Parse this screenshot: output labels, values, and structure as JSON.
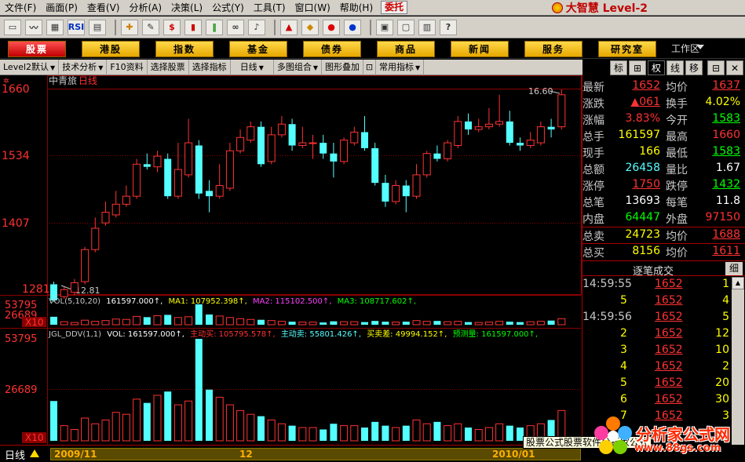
{
  "menu": [
    "文件(F)",
    "画面(P)",
    "查看(V)",
    "分析(A)",
    "决策(L)",
    "公式(Y)",
    "工具(T)",
    "窗口(W)",
    "帮助(H)"
  ],
  "entrust": "委托",
  "brand": "大智慧 Level-2",
  "toolbar": {
    "rsi": "RSI",
    "dollar": "$"
  },
  "nav": [
    "股票",
    "港股",
    "指数",
    "基金",
    "债券",
    "商品",
    "新闻",
    "服务",
    "研究室"
  ],
  "workspace": "工作区",
  "subbar": [
    "Level2默认",
    "技术分析",
    "F10资料",
    "选择股票",
    "选择指标",
    "日线",
    "多图组合",
    "图形叠加",
    "常用指标"
  ],
  "right_tabs": [
    "标",
    "⊞",
    "权",
    "线",
    "移"
  ],
  "chart": {
    "name": "中青旅",
    "period": "日线",
    "price_labels": [
      "1660",
      "1534",
      "1407",
      "1281"
    ],
    "high_mark": "16.60",
    "low_mark": "12.81",
    "vol_labels": [
      "53795",
      "26689",
      "X10"
    ],
    "ddv_labels": [
      "53795",
      "26689",
      "X10"
    ],
    "vol_title": "VOL(5,10,20)",
    "vol_value": "161597.000↑,",
    "ma1": "MA1: 107952.398↑,",
    "ma2": "MA2: 115102.500↑,",
    "ma3": "MA3: 108717.602↑,",
    "ddv_title": "JGL_DDV(1,1)",
    "ddv_vol": "VOL: 161597.000↑,",
    "ddv_buy": "主动买: 105795.578↑,",
    "ddv_sell": "主动卖: 55801.426↑,",
    "ddv_diff": "买卖差: 49994.152↑,",
    "ddv_pred": "预测量: 161597.000↑,"
  },
  "chart_data": {
    "type": "candlestick",
    "price_ylim": [
      1281,
      1660
    ],
    "candles": [
      [
        1295,
        1265,
        1300,
        1262
      ],
      [
        1272,
        1285,
        1290,
        1268
      ],
      [
        1280,
        1298,
        1305,
        1275
      ],
      [
        1300,
        1360,
        1365,
        1295
      ],
      [
        1360,
        1400,
        1420,
        1355
      ],
      [
        1410,
        1430,
        1450,
        1405
      ],
      [
        1425,
        1445,
        1470,
        1420
      ],
      [
        1445,
        1460,
        1480,
        1440
      ],
      [
        1460,
        1520,
        1530,
        1455
      ],
      [
        1520,
        1515,
        1540,
        1510
      ],
      [
        1515,
        1535,
        1545,
        1505
      ],
      [
        1530,
        1460,
        1540,
        1455
      ],
      [
        1460,
        1510,
        1560,
        1455
      ],
      [
        1500,
        1560,
        1605,
        1495
      ],
      [
        1555,
        1465,
        1565,
        1455
      ],
      [
        1470,
        1460,
        1490,
        1430
      ],
      [
        1460,
        1480,
        1520,
        1455
      ],
      [
        1475,
        1545,
        1560,
        1470
      ],
      [
        1545,
        1570,
        1585,
        1540
      ],
      [
        1565,
        1590,
        1600,
        1560
      ],
      [
        1590,
        1520,
        1600,
        1515
      ],
      [
        1525,
        1575,
        1590,
        1520
      ],
      [
        1575,
        1595,
        1610,
        1570
      ],
      [
        1595,
        1555,
        1605,
        1545
      ],
      [
        1555,
        1560,
        1590,
        1550
      ],
      [
        1560,
        1560,
        1575,
        1530
      ],
      [
        1560,
        1540,
        1575,
        1530
      ],
      [
        1540,
        1525,
        1560,
        1495
      ],
      [
        1525,
        1565,
        1570,
        1520
      ],
      [
        1560,
        1580,
        1590,
        1555
      ],
      [
        1580,
        1550,
        1610,
        1545
      ],
      [
        1550,
        1485,
        1560,
        1480
      ],
      [
        1485,
        1450,
        1500,
        1440
      ],
      [
        1450,
        1480,
        1490,
        1445
      ],
      [
        1480,
        1460,
        1490,
        1430
      ],
      [
        1460,
        1500,
        1520,
        1455
      ],
      [
        1500,
        1540,
        1545,
        1495
      ],
      [
        1540,
        1530,
        1555,
        1525
      ],
      [
        1530,
        1560,
        1565,
        1525
      ],
      [
        1555,
        1600,
        1610,
        1550
      ],
      [
        1600,
        1585,
        1615,
        1575
      ],
      [
        1585,
        1590,
        1605,
        1580
      ],
      [
        1590,
        1595,
        1625,
        1585
      ],
      [
        1595,
        1600,
        1650,
        1590
      ],
      [
        1600,
        1560,
        1620,
        1555
      ],
      [
        1560,
        1555,
        1570,
        1545
      ],
      [
        1555,
        1565,
        1580,
        1550
      ],
      [
        1560,
        1590,
        1600,
        1555
      ],
      [
        1590,
        1585,
        1605,
        1570
      ],
      [
        1590,
        1650,
        1660,
        1585
      ]
    ],
    "vol_ylim": [
      0,
      53795
    ],
    "volumes": [
      21000,
      8000,
      6000,
      12000,
      9000,
      11000,
      15000,
      14000,
      22000,
      20000,
      24000,
      26000,
      19000,
      21000,
      53795,
      27000,
      23000,
      19000,
      16000,
      14000,
      13000,
      11000,
      9000,
      8000,
      7000,
      7000,
      6000,
      9000,
      8000,
      8000,
      7000,
      10000,
      8000,
      7000,
      8000,
      11000,
      9000,
      10000,
      8000,
      9000,
      7000,
      6000,
      7000,
      9000,
      8000,
      7000,
      8000,
      9000,
      11000,
      16000
    ]
  },
  "quote": [
    {
      "l1": "最新",
      "v1": "1652",
      "l2": "均价",
      "v2": "1637"
    },
    {
      "l1": "涨跌",
      "v1": "▲061",
      "l2": "换手",
      "v2": "4.02%"
    },
    {
      "l1": "涨幅",
      "v1": "3.83%",
      "l2": "今开",
      "v2": "1583"
    },
    {
      "l1": "总手",
      "v1": "161597",
      "l2": "最高",
      "v2": "1660"
    },
    {
      "l1": "现手",
      "v1": "166",
      "l2": "最低",
      "v2": "1583"
    },
    {
      "l1": "总额",
      "v1": "26458",
      "l2": "量比",
      "v2": "1.67"
    },
    {
      "l1": "涨停",
      "v1": "1750",
      "l2": "跌停",
      "v2": "1432"
    },
    {
      "l1": "总笔",
      "v1": "13693",
      "l2": "每笔",
      "v2": "11.8"
    },
    {
      "l1": "内盘",
      "v1": "64447",
      "l2": "外盘",
      "v2": "97150"
    },
    {
      "l1": "总卖",
      "v1": "24723",
      "l2": "均价",
      "v2": "1688"
    },
    {
      "l1": "总买",
      "v1": "8156",
      "l2": "均价",
      "v2": "1611"
    }
  ],
  "ticks_title": "逐笔成交",
  "ticks_detail": "细",
  "ticks": [
    {
      "t": "14:59:55",
      "p": "1652",
      "q": "1"
    },
    {
      "t": "5",
      "p": "1652",
      "q": "4"
    },
    {
      "t": "14:59:56",
      "p": "1652",
      "q": "5"
    },
    {
      "t": "2",
      "p": "1652",
      "q": "12"
    },
    {
      "t": "3",
      "p": "1652",
      "q": "10"
    },
    {
      "t": "4",
      "p": "1652",
      "q": "2"
    },
    {
      "t": "5",
      "p": "1652",
      "q": "20"
    },
    {
      "t": "6",
      "p": "1652",
      "q": "30"
    },
    {
      "t": "7",
      "p": "1652",
      "q": "3"
    }
  ],
  "bottom": {
    "period": "日线",
    "d1": "2009/11",
    "d2": "12",
    "d3": "2010/01"
  },
  "tooltip": "股票公式股票软件分析家公式",
  "watermark": {
    "main": "分析家公式网",
    "sub": "www.88gs.com"
  },
  "colors": {
    "up": "#ff3232",
    "down": "#54ffff",
    "label": "#c8c8c8"
  }
}
